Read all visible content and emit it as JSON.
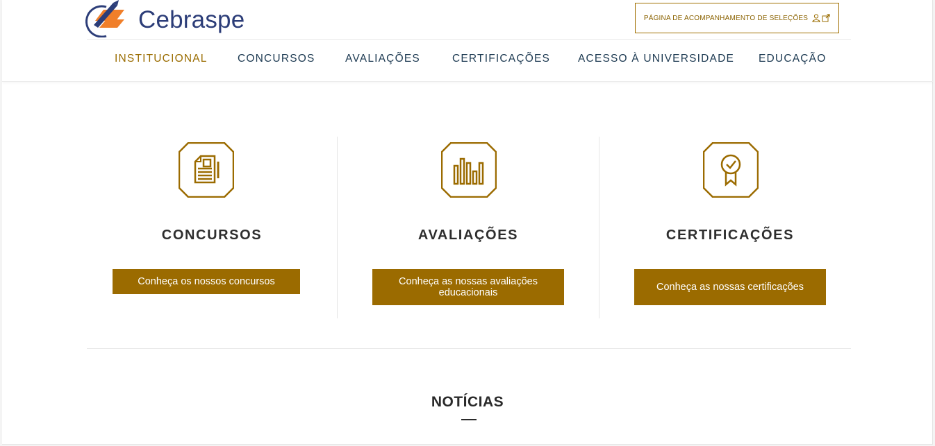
{
  "brand": {
    "name": "Cebraspe",
    "color": "#2c3d78",
    "accent": "#f07f2a"
  },
  "header": {
    "track_button": {
      "label": "PÁGINA DE ACOMPANHAMENTO DE SELEÇÕES",
      "icons": [
        "user-icon",
        "external-link-icon"
      ]
    }
  },
  "nav": {
    "items": [
      {
        "label": "INSTITUCIONAL",
        "active": true
      },
      {
        "label": "CONCURSOS",
        "active": false
      },
      {
        "label": "AVALIAÇÕES",
        "active": false
      },
      {
        "label": "CERTIFICAÇÕES",
        "active": false
      },
      {
        "label": "ACESSO À UNIVERSIDADE",
        "active": false
      },
      {
        "label": "EDUCAÇÃO",
        "active": false
      }
    ]
  },
  "cards": [
    {
      "icon": "document-icon",
      "title": "CONCURSOS",
      "button": "Conheça os nossos concursos"
    },
    {
      "icon": "bar-chart-icon",
      "title": "AVALIAÇÕES",
      "button": "Conheça as nossas avaliações educacionais"
    },
    {
      "icon": "certificate-icon",
      "title": "CERTIFICAÇÕES",
      "button": "Conheça as nossas certificações"
    }
  ],
  "news": {
    "title": "NOTÍCIAS"
  },
  "colors": {
    "gold": "#9b6b00",
    "navy": "#1d3a52"
  }
}
